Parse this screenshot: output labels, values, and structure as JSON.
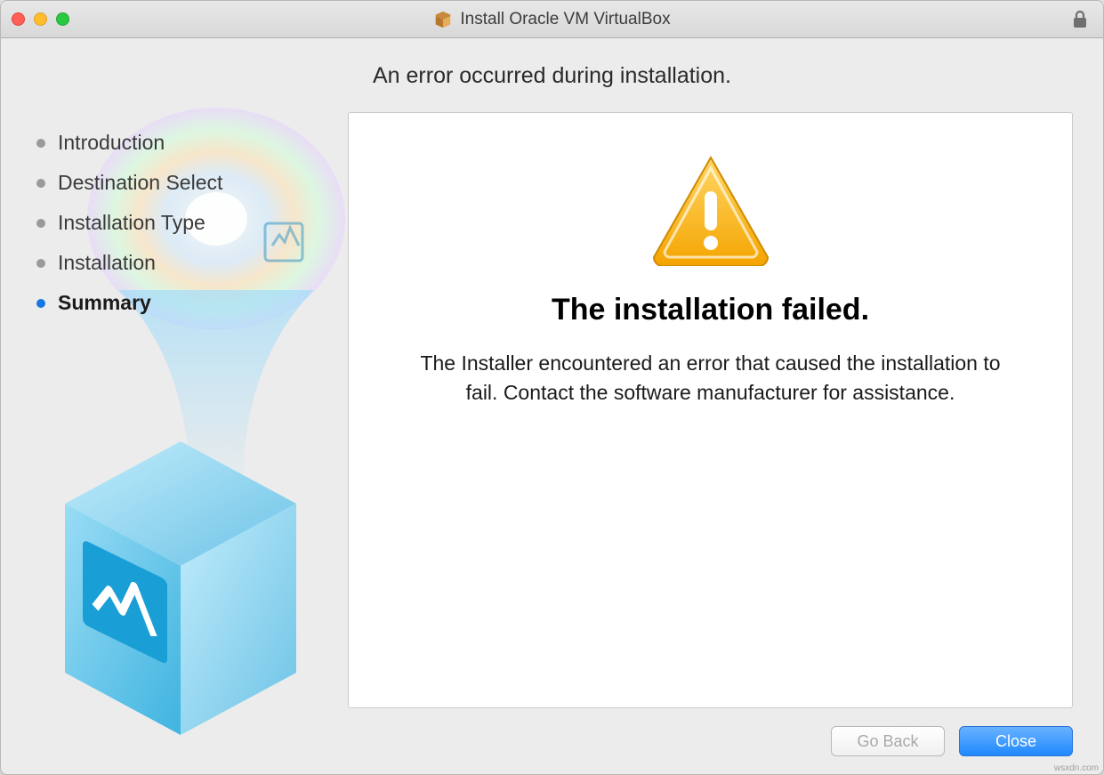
{
  "window": {
    "title": "Install Oracle VM VirtualBox"
  },
  "heading": "An error occurred during installation.",
  "sidebar": {
    "steps": [
      {
        "label": "Introduction",
        "active": false
      },
      {
        "label": "Destination Select",
        "active": false
      },
      {
        "label": "Installation Type",
        "active": false
      },
      {
        "label": "Installation",
        "active": false
      },
      {
        "label": "Summary",
        "active": true
      }
    ]
  },
  "panel": {
    "title": "The installation failed.",
    "body": "The Installer encountered an error that caused the installation to fail. Contact the software manufacturer for assistance."
  },
  "footer": {
    "back_label": "Go Back",
    "close_label": "Close"
  },
  "icons": {
    "package": "package-icon",
    "lock": "lock-icon",
    "warning": "warning-icon"
  },
  "colors": {
    "accent": "#1f89ff",
    "warning": "#f7b500"
  },
  "watermark": "wsxdn.com"
}
